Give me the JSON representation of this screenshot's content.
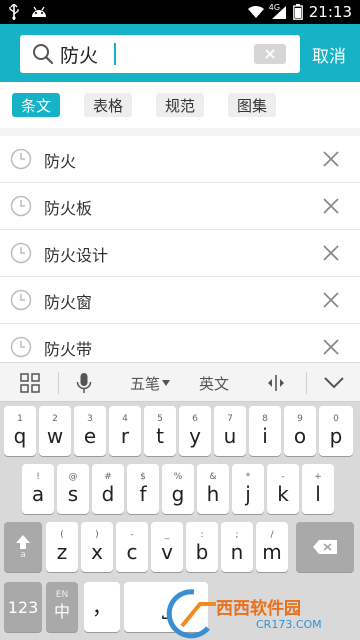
{
  "status_bar": {
    "time": "21:13",
    "network_type": "4G",
    "icons": [
      "usb-icon",
      "android-icon",
      "wifi-icon",
      "cellular-icon",
      "battery-icon"
    ]
  },
  "header": {
    "search_value": "防火",
    "cancel_label": "取消",
    "accent_color": "#16b3c7"
  },
  "tabs": [
    {
      "label": "条文",
      "active": true
    },
    {
      "label": "表格",
      "active": false
    },
    {
      "label": "规范",
      "active": false
    },
    {
      "label": "图集",
      "active": false
    }
  ],
  "history": [
    {
      "label": "防火"
    },
    {
      "label": "防火板"
    },
    {
      "label": "防火设计"
    },
    {
      "label": "防火窗"
    },
    {
      "label": "防火带"
    }
  ],
  "ime_toolbar": {
    "mode_label": "五笔",
    "language_label": "英文"
  },
  "keyboard": {
    "row1": [
      {
        "sub": "1",
        "main": "q"
      },
      {
        "sub": "2",
        "main": "w"
      },
      {
        "sub": "3",
        "main": "e"
      },
      {
        "sub": "4",
        "main": "r"
      },
      {
        "sub": "5",
        "main": "t"
      },
      {
        "sub": "6",
        "main": "y"
      },
      {
        "sub": "7",
        "main": "u"
      },
      {
        "sub": "8",
        "main": "i"
      },
      {
        "sub": "9",
        "main": "o"
      },
      {
        "sub": "0",
        "main": "p"
      }
    ],
    "row2": [
      {
        "sub": "!",
        "main": "a"
      },
      {
        "sub": "@",
        "main": "s"
      },
      {
        "sub": "#",
        "main": "d"
      },
      {
        "sub": "$",
        "main": "f"
      },
      {
        "sub": "%",
        "main": "g"
      },
      {
        "sub": "&",
        "main": "h"
      },
      {
        "sub": "*",
        "main": "j"
      },
      {
        "sub": "-",
        "main": "k"
      },
      {
        "sub": "+",
        "main": "l"
      }
    ],
    "row3": [
      {
        "sub": "(",
        "main": "z"
      },
      {
        "sub": ")",
        "main": "x"
      },
      {
        "sub": "-",
        "main": "c"
      },
      {
        "sub": "_",
        "main": "v"
      },
      {
        "sub": ":",
        "main": "b"
      },
      {
        "sub": ";",
        "main": "n"
      },
      {
        "sub": "/",
        "main": "m"
      }
    ],
    "shift_sub": "a",
    "num_label": "123",
    "lang_sub": "EN",
    "lang_main": "中",
    "comma": "，",
    "space": "⎵"
  },
  "watermark": {
    "brand": "西西软件园",
    "url": "CR173.COM"
  }
}
